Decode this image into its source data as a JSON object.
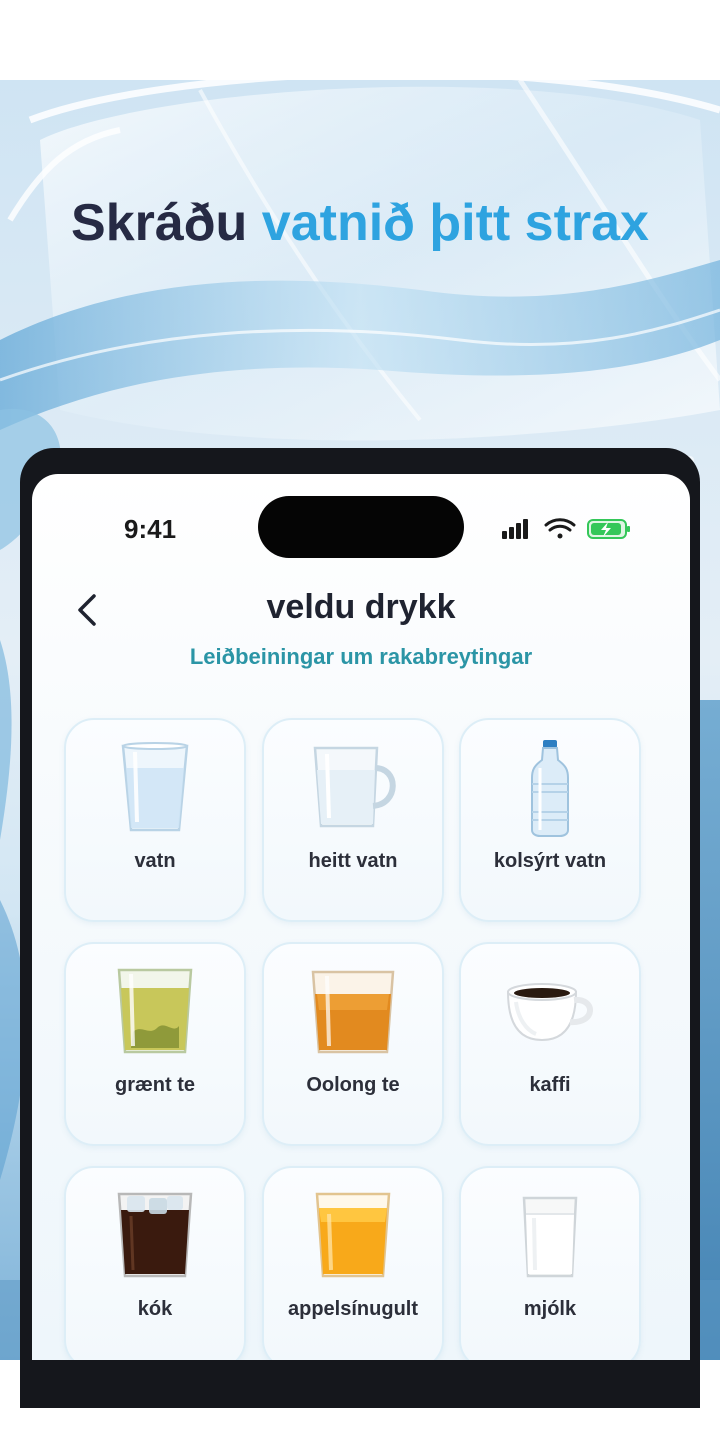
{
  "headline": {
    "dark": "Skráðu",
    "accent": "vatnið þitt strax"
  },
  "status_bar": {
    "time": "9:41"
  },
  "nav": {
    "title": "veldu drykk",
    "subtitle": "Leiðbeiningar um rakabreytingar"
  },
  "drinks": [
    {
      "label": "vatn",
      "icon": "water-glass-icon"
    },
    {
      "label": "heitt vatn",
      "icon": "hot-water-mug-icon"
    },
    {
      "label": "kolsýrt vatn",
      "icon": "sparkling-water-bottle-icon"
    },
    {
      "label": "grænt te",
      "icon": "green-tea-glass-icon"
    },
    {
      "label": "Oolong te",
      "icon": "oolong-tea-glass-icon"
    },
    {
      "label": "kaffi",
      "icon": "coffee-cup-icon"
    },
    {
      "label": "kók",
      "icon": "cola-glass-icon"
    },
    {
      "label": "appelsínugult",
      "icon": "orange-juice-glass-icon"
    },
    {
      "label": "mjólk",
      "icon": "milk-glass-icon"
    }
  ],
  "colors": {
    "accent": "#2ea3e0",
    "headline_dark": "#262a44",
    "link": "#2b95a6",
    "battery": "#34c759"
  }
}
